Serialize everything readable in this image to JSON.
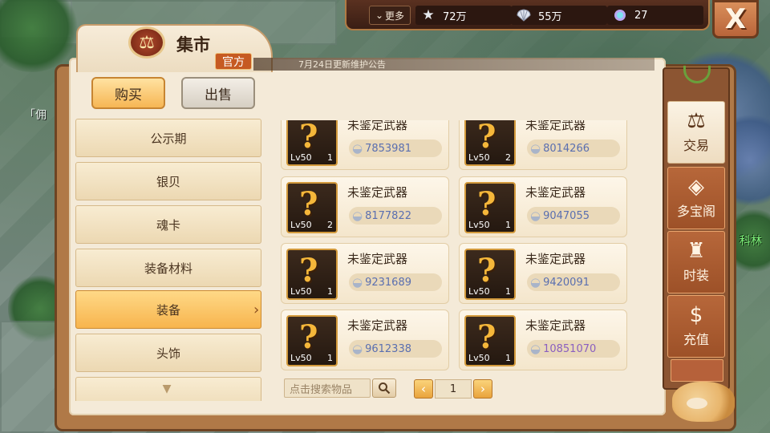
{
  "hud": {
    "more_label": "更多",
    "resources": [
      {
        "icon": "star-icon",
        "value": "72万"
      },
      {
        "icon": "shell-icon",
        "value": "55万"
      },
      {
        "icon": "gem-icon",
        "value": "27"
      }
    ],
    "close_label": "X"
  },
  "world": {
    "left_label": "「佣",
    "right_label": "科林"
  },
  "market": {
    "title": "集市",
    "official_badge": "官方",
    "notice": "7月24日更新维护公告",
    "tabs": {
      "buy": "购买",
      "sell": "出售"
    },
    "categories": [
      "公示期",
      "银贝",
      "魂卡",
      "装备材料",
      "装备",
      "头饰"
    ],
    "active_category": "装备",
    "items": [
      {
        "name": "未鉴定武器",
        "level": "Lv50",
        "count": "1",
        "price": "7853981"
      },
      {
        "name": "未鉴定武器",
        "level": "Lv50",
        "count": "2",
        "price": "8014266"
      },
      {
        "name": "未鉴定武器",
        "level": "Lv50",
        "count": "2",
        "price": "8177822"
      },
      {
        "name": "未鉴定武器",
        "level": "Lv50",
        "count": "1",
        "price": "9047055"
      },
      {
        "name": "未鉴定武器",
        "level": "Lv50",
        "count": "1",
        "price": "9231689"
      },
      {
        "name": "未鉴定武器",
        "level": "Lv50",
        "count": "1",
        "price": "9420091"
      },
      {
        "name": "未鉴定武器",
        "level": "Lv50",
        "count": "1",
        "price": "9612338"
      },
      {
        "name": "未鉴定武器",
        "level": "Lv50",
        "count": "1",
        "price": "10851070"
      }
    ],
    "search_placeholder": "点击搜索物品",
    "page": "1"
  },
  "side_tabs": [
    {
      "icon": "scale-icon",
      "label": "交易",
      "active": true
    },
    {
      "icon": "treasure-icon",
      "label": "多宝阁",
      "active": false
    },
    {
      "icon": "costume-icon",
      "label": "时装",
      "active": false
    },
    {
      "icon": "dollar-icon",
      "label": "充值",
      "active": false
    }
  ],
  "colors": {
    "accent": "#f7b44d",
    "panel": "#f4ead8",
    "frame": "#b07947",
    "price_text": "#5a6fb0"
  }
}
